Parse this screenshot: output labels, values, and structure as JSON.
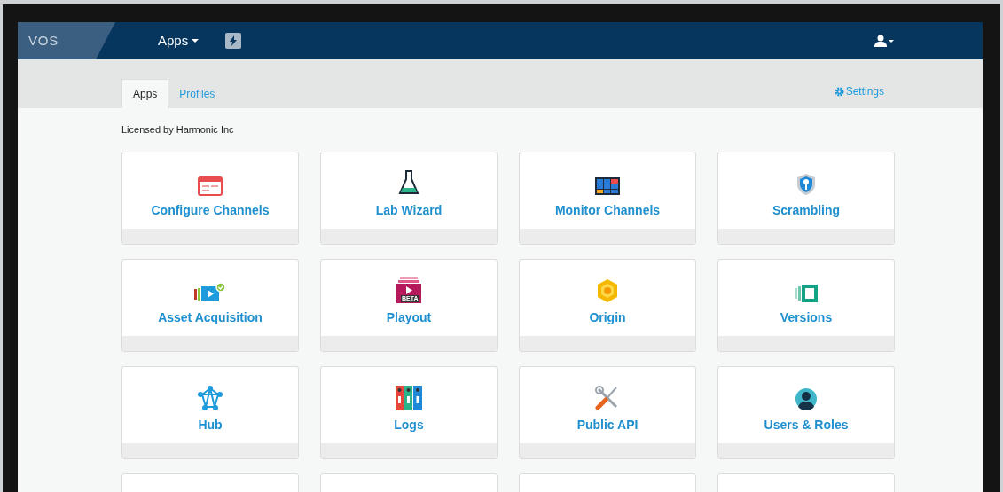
{
  "navbar": {
    "logo": "VOS",
    "menu": "Apps"
  },
  "tabs": [
    {
      "label": "Apps",
      "selected": true
    },
    {
      "label": "Profiles",
      "selected": false
    }
  ],
  "settings_link": "Settings",
  "license_note": "Licensed by Harmonic Inc",
  "apps": [
    {
      "kind": "configure",
      "label": "Configure Channels"
    },
    {
      "kind": "lab",
      "label": "Lab Wizard"
    },
    {
      "kind": "monitor",
      "label": "Monitor Channels"
    },
    {
      "kind": "scrambling",
      "label": "Scrambling"
    },
    {
      "kind": "asset",
      "label": "Asset Acquisition"
    },
    {
      "kind": "playout",
      "label": "Playout",
      "badge": "BETA"
    },
    {
      "kind": "origin",
      "label": "Origin"
    },
    {
      "kind": "versions",
      "label": "Versions"
    },
    {
      "kind": "hub",
      "label": "Hub"
    },
    {
      "kind": "logs",
      "label": "Logs"
    },
    {
      "kind": "api",
      "label": "Public API"
    },
    {
      "kind": "users",
      "label": "Users & Roles"
    }
  ]
}
